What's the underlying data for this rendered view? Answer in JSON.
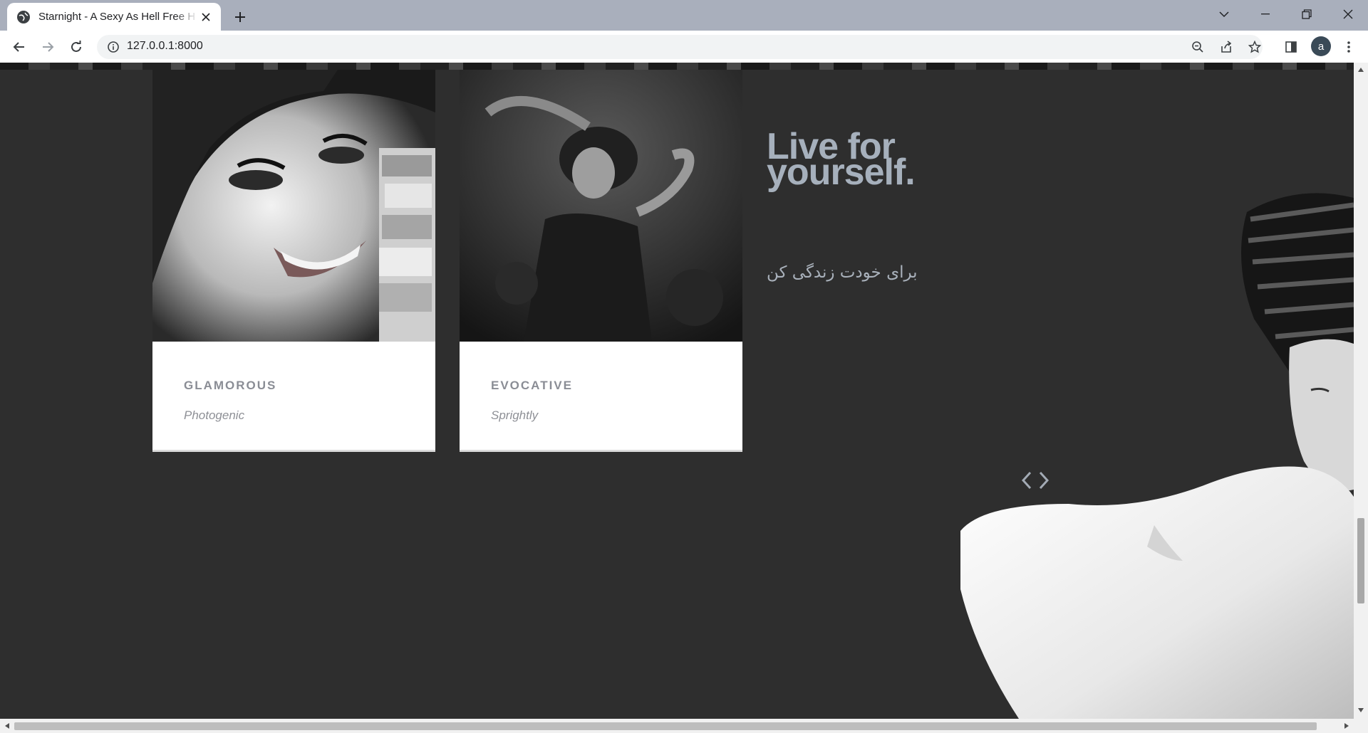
{
  "browser": {
    "tab_title": "Starnight - A Sexy As Hell Free H",
    "url": "127.0.0.1:8000",
    "profile_initial": "a"
  },
  "cards": [
    {
      "title": "GLAMOROUS",
      "subtitle": "Photogenic"
    },
    {
      "title": "EVOCATIVE",
      "subtitle": "Sprightly"
    }
  ],
  "hero": {
    "headline_line1": "Live for",
    "headline_line2": "yourself.",
    "persian_text": "برای خودت زندگی کن"
  },
  "icons": {
    "favicon": "globe-icon",
    "prev": "chevron-left-icon",
    "next": "chevron-right-icon"
  },
  "colors": {
    "page_bg": "#2e2e2e",
    "headline": "#a6b0bc",
    "card_title": "#8a8d95",
    "tabstrip": "#a9afbc"
  }
}
